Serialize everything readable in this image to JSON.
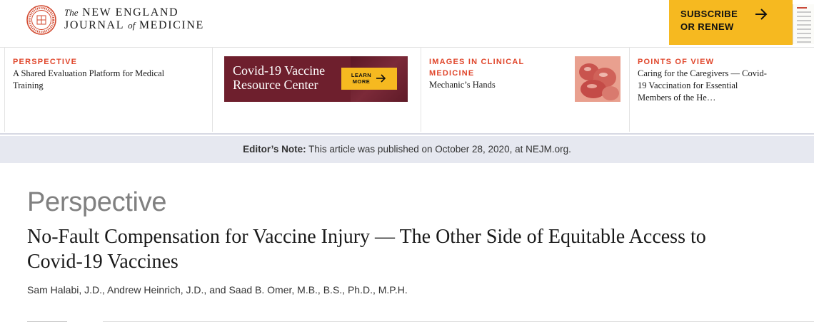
{
  "header": {
    "logo_line1_prefix": "The",
    "logo_line1_main": "NEW ENGLAND",
    "logo_line2_main1": "JOURNAL",
    "logo_line2_of": "of",
    "logo_line2_main2": "MEDICINE",
    "subscribe_label": "SUBSCRIBE OR RENEW",
    "subscribe_icon": "arrow-right-icon"
  },
  "promo": {
    "perspective": {
      "kicker": "PERSPECTIVE",
      "title": "A Shared Evaluation Platform for Medical Training"
    },
    "vaccine": {
      "title": "Covid-19 Vaccine Resource Center",
      "button_label": "LEARN MORE",
      "button_icon": "arrow-right-icon"
    },
    "images": {
      "kicker": "IMAGES IN CLINICAL MEDICINE",
      "title": "Mechanic’s Hands"
    },
    "points": {
      "kicker": "POINTS OF VIEW",
      "title": "Caring for the Caregivers — Covid-19 Vaccination for Essential Members of the He…"
    }
  },
  "editors_note": {
    "label": "Editor’s Note:",
    "text": " This article was published on October 28, 2020, at NEJM.org."
  },
  "article": {
    "section": "Perspective",
    "title": "No-Fault Compensation for Vaccine Injury — The Other Side of Equitable Access to Covid-19 Vaccines",
    "authors": "Sam Halabi, J.D., Andrew Heinrich, J.D., and Saad B. Omer, M.B., B.S., Ph.D., M.P.H."
  },
  "colors": {
    "accent_gold": "#f6b920",
    "kicker_red": "#e0462b",
    "banner_maroon": "#6e1f2d",
    "note_bg": "#e6e8f0"
  }
}
